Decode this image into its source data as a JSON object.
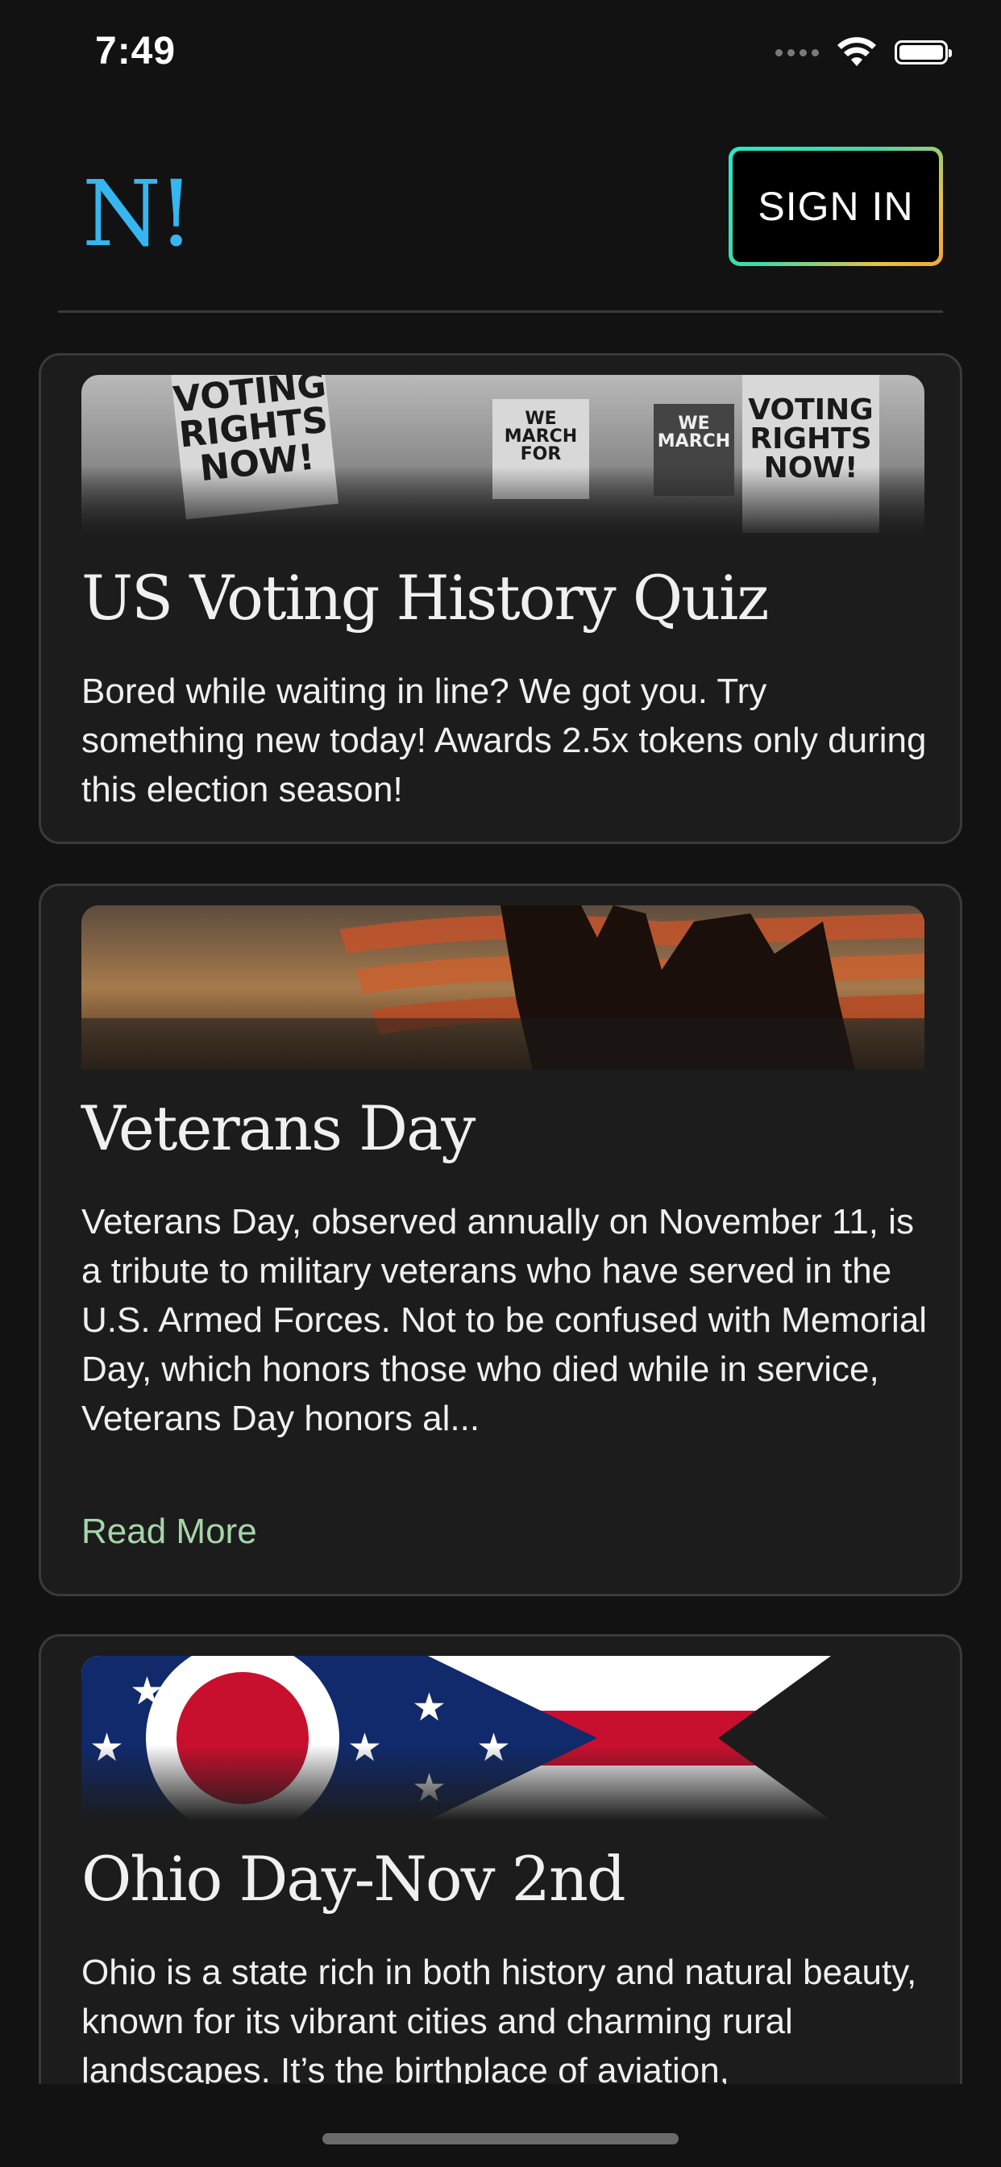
{
  "status_bar": {
    "time": "7:49",
    "icons": [
      "cellular-dots-icon",
      "wifi-icon",
      "battery-icon"
    ]
  },
  "header": {
    "logo_text": "N!",
    "sign_in_label": "SIGN IN",
    "colors": {
      "logo": "#35b6f0",
      "button_gradient_start": "#2ee6c9",
      "button_gradient_end": "#f0a53a"
    }
  },
  "feed": {
    "cards": [
      {
        "image": "voting-rights-protest-image",
        "title": "US Voting History Quiz",
        "body": "Bored while waiting in line? We got you. Try something new today! Awards 2.5x tokens only during this election season!",
        "image_sign_texts": [
          "VOTING RIGHTS NOW!",
          "WE MARCH FOR",
          "WE MARCH",
          "VOTING RIGHTS NOW!"
        ]
      },
      {
        "image": "veterans-flag-salute-image",
        "title": "Veterans Day",
        "body": "Veterans Day, observed annually on November 11, is a tribute to military veterans who have served in the U.S. Armed Forces. Not to be confused with Memorial Day, which honors those who died while in service, Veterans Day honors al...",
        "read_more": "Read More"
      },
      {
        "image": "ohio-flag-image",
        "title": "Ohio Day-Nov 2nd",
        "body": "Ohio is a state rich in both history and natural beauty, known for its vibrant cities and charming rural landscapes. It’s the birthplace of aviation,"
      }
    ],
    "read_more_color": "#a6d6a8"
  }
}
